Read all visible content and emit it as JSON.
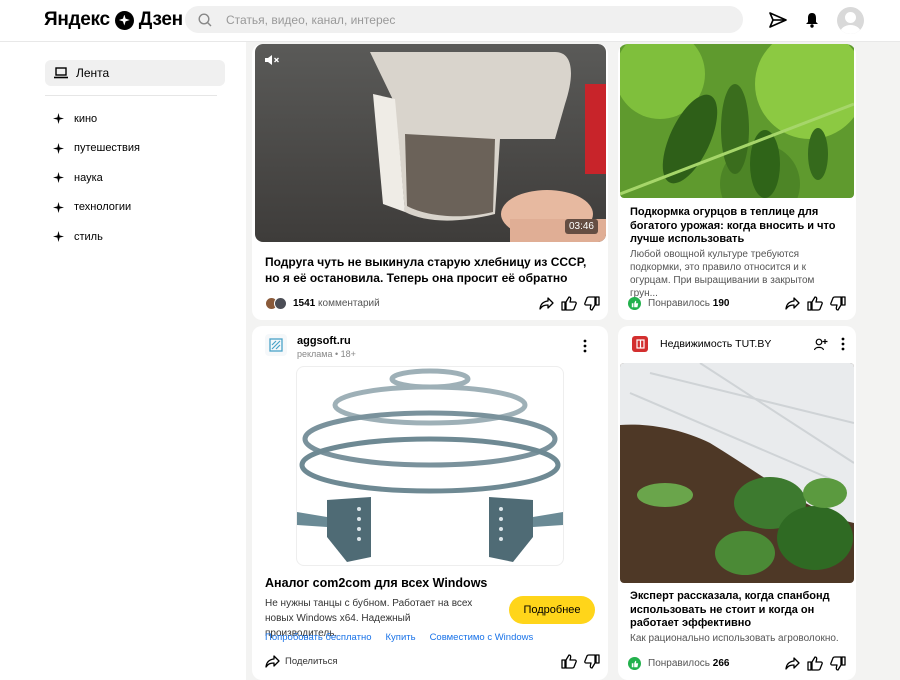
{
  "header": {
    "logo_left": "Яндекс",
    "logo_right": "Дзен",
    "search_placeholder": "Статья, видео, канал, интерес"
  },
  "sidebar": {
    "feed_label": "Лента",
    "topics": [
      "кино",
      "путешествия",
      "наука",
      "технологии",
      "стиль"
    ]
  },
  "cards": {
    "video": {
      "duration": "03:46",
      "title": "Подруга чуть не выкинула старую хлебницу из СССР, но я её остановила. Теперь она просит её обратно",
      "comments_count": "1541",
      "comments_label": "комментарий"
    },
    "cucumbers": {
      "title": "Подкормка огурцов в теплице для богатого урожая: когда вносить и что лучше использовать",
      "desc": "Любой овощной культуре требуются подкормки, это правило относится и к огурцам. При выращивании в закрытом грун...",
      "likes_label": "Понравилось",
      "likes_count": "190"
    },
    "ad": {
      "source": "aggsoft.ru",
      "meta": "реклама • 18+",
      "title": "Аналог com2com для всех Windows",
      "desc": "Не нужны танцы с бубном. Работает на всех новых Windows x64. Надежный производитель.",
      "button": "Подробнее",
      "links": [
        "Попробовать бесплатно",
        "Купить",
        "Совместимо с Windows"
      ],
      "share": "Поделиться"
    },
    "spunbond": {
      "source": "Недвижимость TUT.BY",
      "title": "Эксперт рассказала, когда спанбонд использовать не стоит и когда он работает эффективно",
      "desc": "Как рационально использовать агроволокно.",
      "likes_label": "Понравилось",
      "likes_count": "266"
    }
  },
  "colors": {
    "accent_yellow": "#ffd51a",
    "like_green": "#23b14d",
    "link_blue": "#1a73e8",
    "tut_red": "#d32f2f"
  }
}
